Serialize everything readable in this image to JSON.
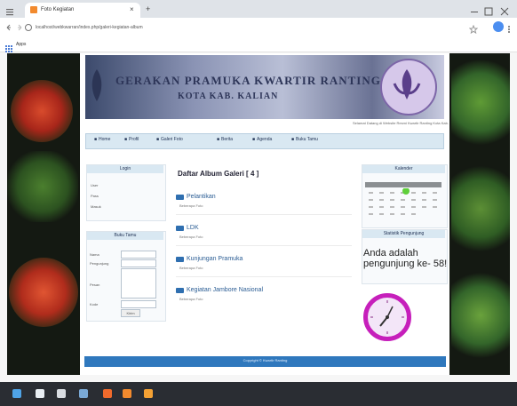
{
  "browser": {
    "tab_title": "Foto Kegiatan",
    "tab_close": "×",
    "new_tab": "+",
    "url": "localhost/webkwarran/index.php/galeri-kegiatan-album",
    "bookmark_label": "Apps"
  },
  "page": {
    "banner": {
      "title": "GERAKAN PRAMUKA KWARTIR RANTING",
      "subtitle": "KOTA KAB. KALIAN"
    },
    "marquee_text": "Selamat Datang di Website Resmi Kwartir Ranting Kota Kab.",
    "nav": [
      {
        "label": "Home"
      },
      {
        "label": "Profil"
      },
      {
        "label": "Galeri Foto"
      },
      {
        "label": "Berita"
      },
      {
        "label": "Agenda"
      },
      {
        "label": "Buku Tamu"
      }
    ],
    "login_panel": {
      "title": "Login",
      "username_label": "User",
      "password_label": "Pass",
      "button": "Masuk"
    },
    "guestbook_panel": {
      "title": "Buku Tamu",
      "name_label": "Nama",
      "email_label": "Pengunjung",
      "email_value": "",
      "message_label": "Pesan",
      "captcha_label": "Kode",
      "button": "Kirim"
    },
    "album": {
      "heading": "Daftar Album Galeri [ 4 ]",
      "items": [
        {
          "name": "Pelantikan",
          "meta": "Beberapa Foto"
        },
        {
          "name": "LDK",
          "meta": "Beberapa Foto"
        },
        {
          "name": "Kunjungan Pramuka",
          "meta": "Beberapa Foto"
        },
        {
          "name": "Kegiatan Jambore Nasional",
          "meta": "Beberapa Foto"
        }
      ]
    },
    "calendar_panel": {
      "title": "Kalender"
    },
    "counter_panel": {
      "title": "Statistik Pengunjung",
      "text": "Anda adalah pengunjung ke- 58!"
    },
    "footer": "Copyright © Kwartir Ranting"
  },
  "colors": {
    "accent": "#2f78bd",
    "clock_ring": "#c61fbb",
    "nav_bg": "#d9e8f2"
  }
}
